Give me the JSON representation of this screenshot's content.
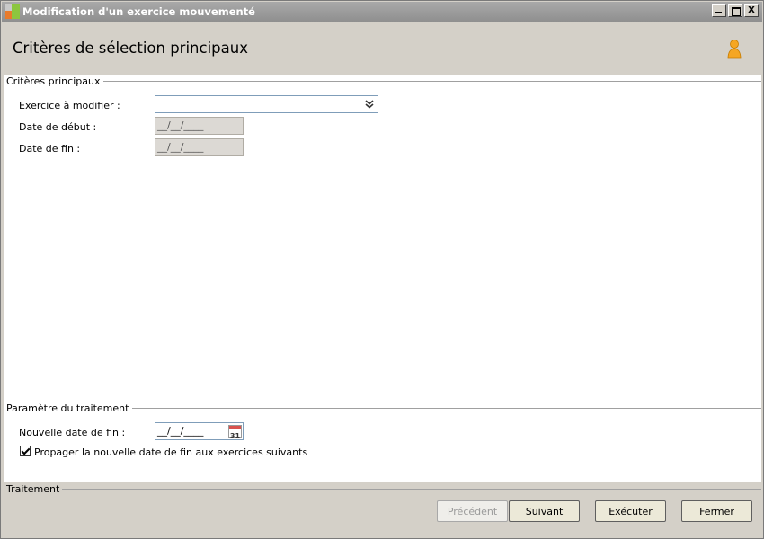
{
  "window": {
    "title": "Modification d'un exercice mouvementé",
    "minimize": "",
    "maximize": "",
    "close": "X"
  },
  "header": {
    "title": "Critères de sélection principaux"
  },
  "criteria": {
    "group_title": "Critères principaux",
    "exercice_label": "Exercice à modifier :",
    "exercice_value": "",
    "date_debut_label": "Date de début :",
    "date_debut_value": "__/__/____",
    "date_fin_label": "Date de fin :",
    "date_fin_value": "__/__/____"
  },
  "params": {
    "group_title": "Paramètre du traitement",
    "nouvelle_date_label": "Nouvelle date de fin :",
    "nouvelle_date_value": "__/__/____",
    "calendar_day": "31",
    "propager_label": "Propager la nouvelle date de fin aux exercices suivants",
    "propager_checked": true
  },
  "footer": {
    "group_title": "Traitement",
    "precedent": "Précédent",
    "suivant": "Suivant",
    "executer": "Exécuter",
    "fermer": "Fermer"
  },
  "colors": {
    "titlebar": "#8f8f8f",
    "user_icon": "#f5a623"
  },
  "icons": {
    "app": "app-icon",
    "user": "user-icon",
    "combo": "chevron-double-down-icon",
    "calendar": "calendar-icon"
  }
}
